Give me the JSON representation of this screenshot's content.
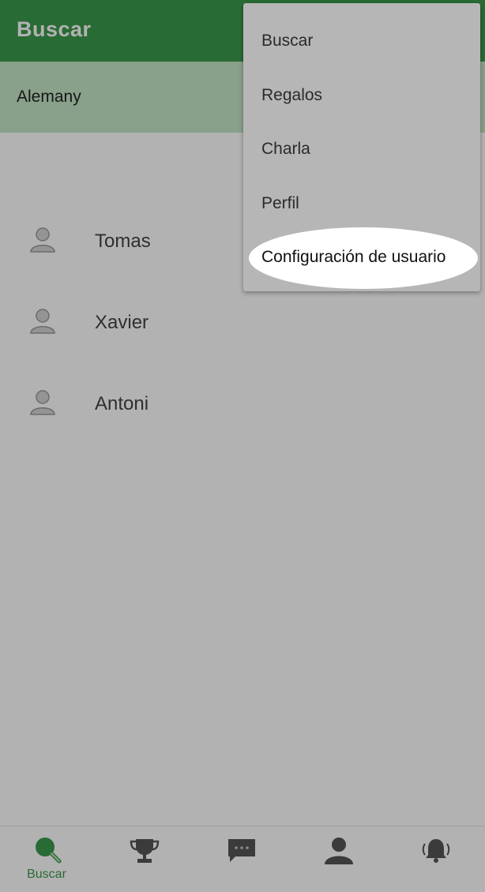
{
  "appbar": {
    "title": "Buscar"
  },
  "filter": {
    "label": "Alemany"
  },
  "users": [
    {
      "name": "Tomas"
    },
    {
      "name": "Xavier"
    },
    {
      "name": "Antoni"
    }
  ],
  "bottom_nav": [
    {
      "icon": "search-icon",
      "label": "Buscar",
      "active": true
    },
    {
      "icon": "trophy-icon",
      "label": ""
    },
    {
      "icon": "chat-icon",
      "label": ""
    },
    {
      "icon": "profile-icon",
      "label": ""
    },
    {
      "icon": "bell-icon",
      "label": ""
    }
  ],
  "menu": {
    "items": [
      {
        "label": "Buscar"
      },
      {
        "label": "Regalos"
      },
      {
        "label": "Charla"
      },
      {
        "label": "Perfil"
      },
      {
        "label": "Configuración de usuario",
        "highlighted": true
      }
    ]
  },
  "colors": {
    "primary": "#3c9a4c",
    "filter_bg": "#c4e6c6",
    "menu_bg": "#b6b6b6"
  }
}
